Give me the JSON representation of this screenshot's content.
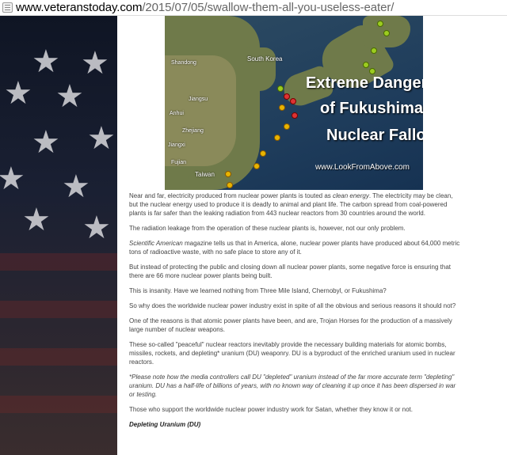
{
  "browser": {
    "url_domain": "www.veteranstoday.com",
    "url_path": "/2015/07/05/swallow-them-all-you-useless-eater/"
  },
  "map": {
    "labels": {
      "south_korea": "South Korea",
      "shandong": "Shandong",
      "anhui": "Anhui",
      "jiangxi": "Jiangxi",
      "zhejiang": "Zhejiang",
      "jiangsu": "Jiangsu",
      "fujian": "Fujian",
      "taiwan": "Taiwan"
    },
    "headline_lines": [
      "Extreme Dangers",
      "of Fukushima",
      "Nuclear Fallout"
    ],
    "credit": "www.LookFromAbove.com"
  },
  "article": {
    "p1_a": "Near and far, electricity produced from nuclear power plants is touted as ",
    "p1_em": "clean energy",
    "p1_b": ". The electricity may be clean, but the nuclear energy used to produce it is deadly to animal and plant life. The carbon spread from coal-powered plants is far safer than the leaking radiation from 443 nuclear reactors from 30 countries around the world.",
    "p2": "The radiation leakage from the operation of these nuclear plants is, however, not our only problem.",
    "p3_em": "Scientific American",
    "p3_b": " magazine tells us that in America, alone, nuclear power plants have produced about 64,000 metric tons of radioactive waste, with no safe place to store any of it.",
    "p4": "But instead of protecting the public and closing down all nuclear power plants, some negative force is ensuring that there are 66 more nuclear power plants being built.",
    "p5": "This is insanity. Have we learned nothing from Three Mile Island, Chernobyl, or Fukushima?",
    "p6": "So why does the worldwide nuclear power industry exist in spite of all the obvious and serious reasons it should not?",
    "p7": "One of the reasons is that atomic power plants have been, and are, Trojan Horses for the production of a massively large number of nuclear weapons.",
    "p8": "These so-called \"peaceful\" nuclear reactors inevitably provide the necessary building materials for atomic bombs, missiles, rockets, and depleting* uranium (DU) weaponry. DU is a byproduct of the enriched uranium used in nuclear reactors.",
    "p9": "*Please note how the media controllers call DU \"depleted\" uranium instead of the far more accurate term \"depleting\" uranium. DU has a half-life of billions of years, with no known way of cleaning it up once it has been dispersed in war or testing.",
    "p10": "Those who support the worldwide nuclear power industry work for Satan, whether they know it or not.",
    "heading": "Depleting Uranium (DU)"
  }
}
